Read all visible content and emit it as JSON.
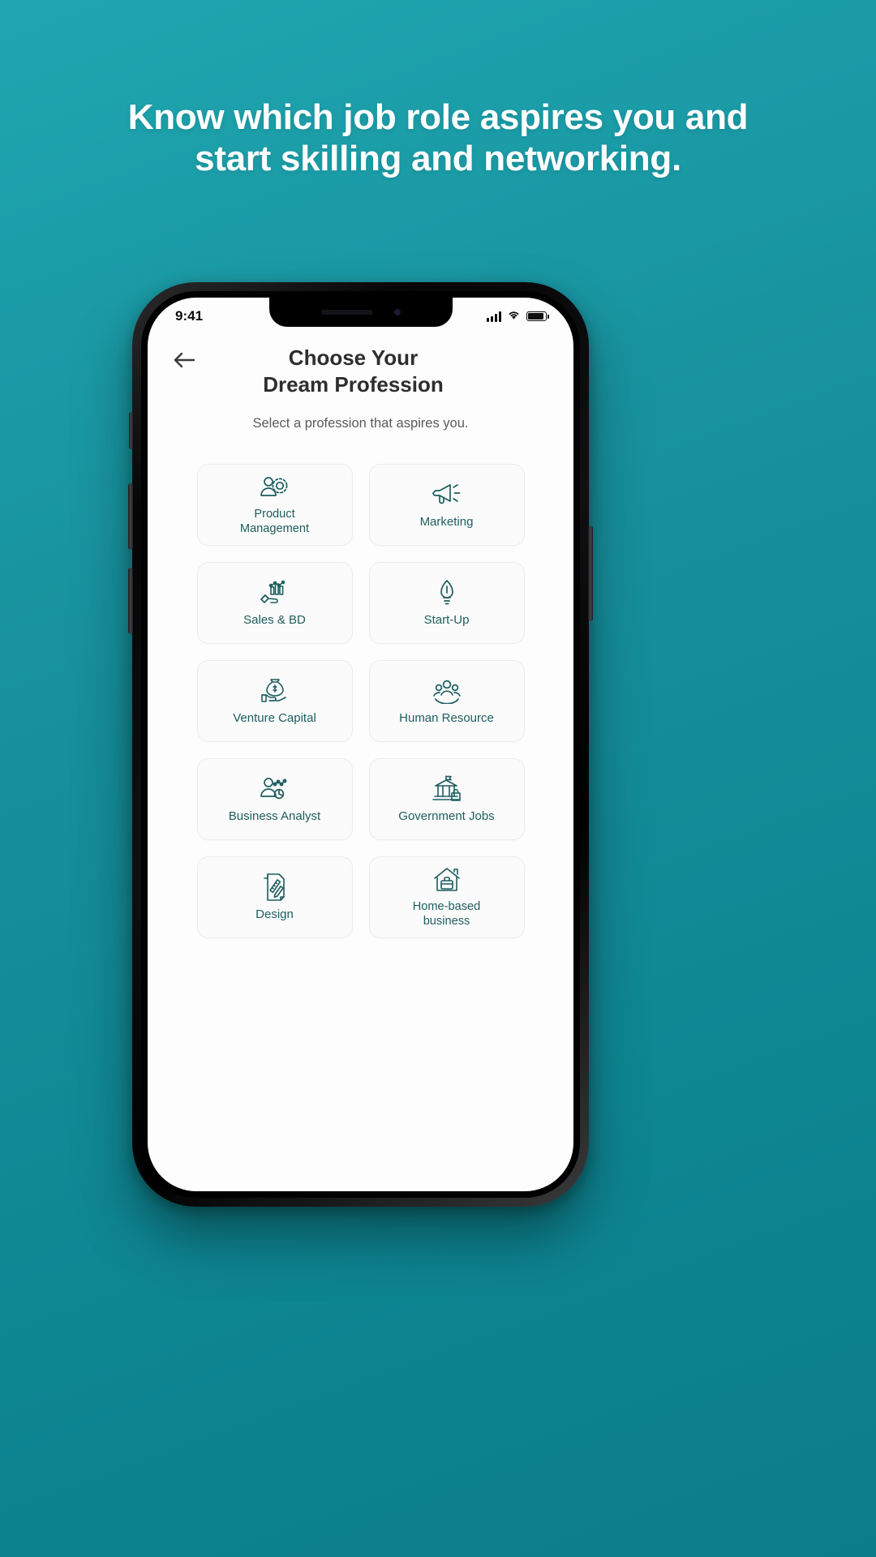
{
  "promo": {
    "headline_line1": "Know which job role aspires you and",
    "headline_line2": "start skilling and networking.",
    "background_color": "#17929e",
    "text_color": "#ffffff"
  },
  "status_bar": {
    "time": "9:41",
    "signal_icon": "cellular-signal-icon",
    "wifi_icon": "wifi-icon",
    "battery_icon": "battery-full-icon"
  },
  "app": {
    "back_icon": "back-arrow-icon",
    "title_line1": "Choose Your",
    "title_line2": "Dream Profession",
    "subtitle": "Select a profession that aspires you.",
    "accent_color": "#1e5d5e",
    "card_border_color": "#ececec",
    "card_background": "#fbfbfb"
  },
  "professions": [
    {
      "label": "Product Management",
      "label_line1": "Product",
      "label_line2": "Management",
      "icon": "people-gear-icon",
      "two_line": true
    },
    {
      "label": "Marketing",
      "label_line1": "Marketing",
      "label_line2": "",
      "icon": "megaphone-icon",
      "two_line": false
    },
    {
      "label": "Sales & BD",
      "label_line1": "Sales & BD",
      "label_line2": "",
      "icon": "hand-bar-chart-icon",
      "two_line": false
    },
    {
      "label": "Start-Up",
      "label_line1": "Start-Up",
      "label_line2": "",
      "icon": "rocket-bulb-icon",
      "two_line": false
    },
    {
      "label": "Venture Capital",
      "label_line1": "Venture Capital",
      "label_line2": "",
      "icon": "money-bag-hand-icon",
      "two_line": false
    },
    {
      "label": "Human Resource",
      "label_line1": "Human Resource",
      "label_line2": "",
      "icon": "people-group-icon",
      "two_line": false
    },
    {
      "label": "Business Analyst",
      "label_line1": "Business Analyst",
      "label_line2": "",
      "icon": "person-analytics-icon",
      "two_line": false
    },
    {
      "label": "Government Jobs",
      "label_line1": "Government Jobs",
      "label_line2": "",
      "icon": "government-building-icon",
      "two_line": false
    },
    {
      "label": "Design",
      "label_line1": "Design",
      "label_line2": "",
      "icon": "ruler-pencil-document-icon",
      "two_line": false
    },
    {
      "label": "Home-based business",
      "label_line1": "Home-based",
      "label_line2": "business",
      "icon": "house-briefcase-icon",
      "two_line": true
    }
  ]
}
